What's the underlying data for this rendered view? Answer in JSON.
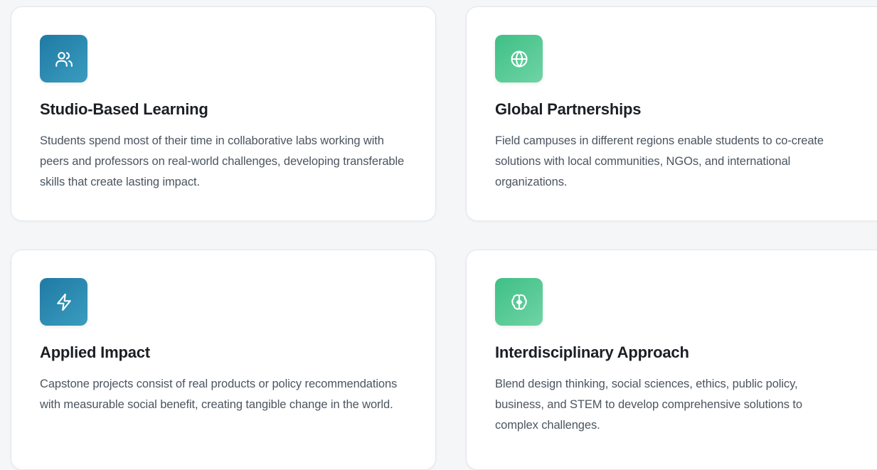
{
  "features": [
    {
      "title": "Studio-Based Learning",
      "description": "Students spend most of their time in collaborative labs working with peers and professors on real-world challenges, developing transferable skills that create lasting impact.",
      "icon": "users-icon",
      "icon_color": "#1f7aa4"
    },
    {
      "title": "Global Partnerships",
      "description": "Field campuses in different regions enable students to co-create solutions with local communities, NGOs, and international organizations.",
      "icon": "globe-icon",
      "icon_color": "#3fbf86"
    },
    {
      "title": "Applied Impact",
      "description": "Capstone projects consist of real products or policy recommendations with measurable social benefit, creating tangible change in the world.",
      "icon": "lightning-icon",
      "icon_color": "#1f7aa4"
    },
    {
      "title": "Interdisciplinary Approach",
      "description": "Blend design thinking, social sciences, ethics, public policy, business, and STEM to develop comprehensive solutions to complex challenges.",
      "icon": "brain-icon",
      "icon_color": "#3fbf86"
    }
  ]
}
